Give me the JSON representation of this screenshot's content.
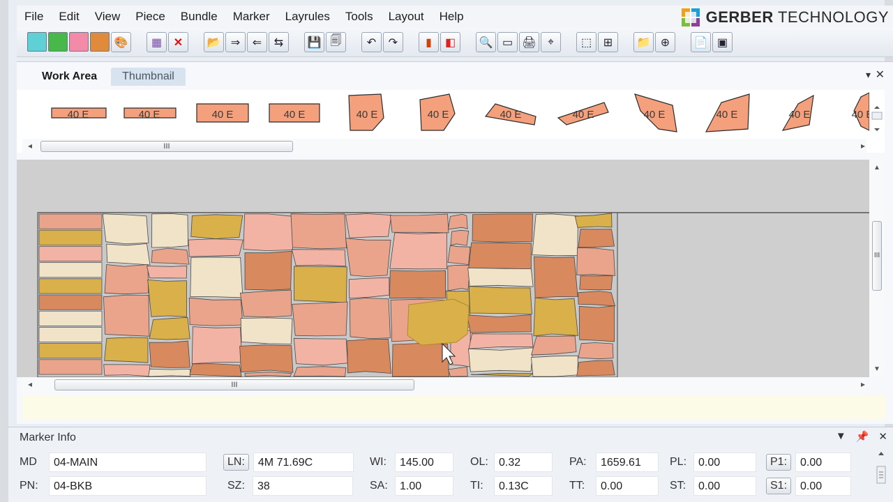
{
  "menu": [
    "File",
    "Edit",
    "View",
    "Piece",
    "Bundle",
    "Marker",
    "Layrules",
    "Tools",
    "Layout",
    "Help"
  ],
  "brand": {
    "bold": "GERBER",
    "rest": " TECHNOLOGY"
  },
  "toolbar": {
    "swatches": [
      "#5fd0d6",
      "#48b84a",
      "#f28aa8",
      "#e08a3c"
    ],
    "icon_names": [
      "palette-icon",
      "select-pieces-icon",
      "delete-icon",
      "open-icon",
      "open-next-icon",
      "import-icon",
      "export-icon",
      "save-icon",
      "save-all-icon",
      "undo-icon",
      "redo-icon",
      "bar-chart-icon",
      "split-icon",
      "zoom-icon",
      "fit-width-icon",
      "view-icon",
      "zoom-area-icon",
      "multi-select-icon",
      "grid-icon",
      "add-folder-icon",
      "add-piece-icon",
      "report-icon",
      "layout-icon"
    ]
  },
  "tabs": [
    {
      "label": "Work Area",
      "active": true
    },
    {
      "label": "Thumbnail",
      "active": false
    }
  ],
  "pieces": {
    "label": "40 E",
    "count": 12,
    "fill": "#f4a07c",
    "stroke": "#2b2b2b"
  },
  "scroll": {
    "thumb_grip": "III"
  },
  "marker": {
    "colors": {
      "salmon": "#eba48c",
      "pink": "#f2b3a4",
      "cream": "#f1e3c8",
      "olive": "#d9b04a",
      "orange": "#d9895e",
      "background": "#cfcfcf"
    },
    "utilization_fraction": 0.68
  },
  "marker_info": {
    "title": "Marker Info",
    "fields": {
      "md": {
        "label": "MD",
        "value": "04-MAIN"
      },
      "pn": {
        "label": "PN:",
        "value": "04-BKB"
      },
      "ln": {
        "label": "LN:",
        "value": "4M 71.69C"
      },
      "sz": {
        "label": "SZ:",
        "value": "38"
      },
      "wi": {
        "label": "WI:",
        "value": "145.00"
      },
      "sa": {
        "label": "SA:",
        "value": "1.00"
      },
      "ol": {
        "label": "OL:",
        "value": "0.32"
      },
      "ti": {
        "label": "TI:",
        "value": "0.13C"
      },
      "pa": {
        "label": "PA:",
        "value": "1659.61"
      },
      "tt": {
        "label": "TT:",
        "value": "0.00"
      },
      "pl": {
        "label": "PL:",
        "value": "0.00"
      },
      "st": {
        "label": "ST:",
        "value": "0.00"
      },
      "p1": {
        "label": "P1:",
        "value": "0.00"
      },
      "s1": {
        "label": "S1:",
        "value": "0.00"
      }
    }
  }
}
